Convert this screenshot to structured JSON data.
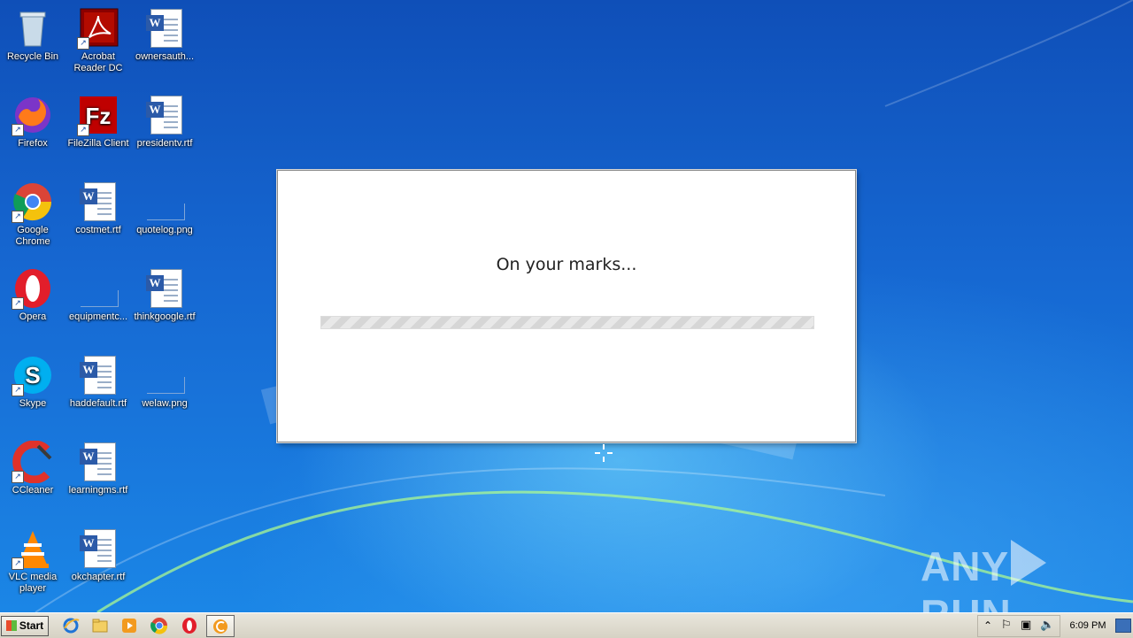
{
  "desktop": {
    "icons": [
      {
        "label": "Recycle Bin"
      },
      {
        "label": "Acrobat Reader DC"
      },
      {
        "label": "ownersauth..."
      },
      {
        "label": "Firefox"
      },
      {
        "label": "FileZilla Client"
      },
      {
        "label": "presidentv.rtf"
      },
      {
        "label": "Google Chrome"
      },
      {
        "label": "costmet.rtf"
      },
      {
        "label": "quotelog.png"
      },
      {
        "label": "Opera"
      },
      {
        "label": "equipmentc..."
      },
      {
        "label": "thinkgoogle.rtf"
      },
      {
        "label": "Skype"
      },
      {
        "label": "haddefault.rtf"
      },
      {
        "label": "welaw.png"
      },
      {
        "label": "CCleaner"
      },
      {
        "label": "learningms.rtf"
      },
      {
        "label": "VLC media player"
      },
      {
        "label": "okchapter.rtf"
      }
    ]
  },
  "dialog": {
    "message": "On your marks...",
    "progress": 0
  },
  "watermark": {
    "left": "ANY",
    "right": "RUN"
  },
  "taskbar": {
    "start_label": "Start",
    "clock": "6:09 PM",
    "pinned": [
      "internet-explorer-icon",
      "folder-icon",
      "media-player-icon",
      "chrome-icon",
      "opera-icon",
      "ccleaner-icon"
    ]
  },
  "colors": {
    "desktop": "#1668d2",
    "taskbar": "#d6d2c4"
  }
}
